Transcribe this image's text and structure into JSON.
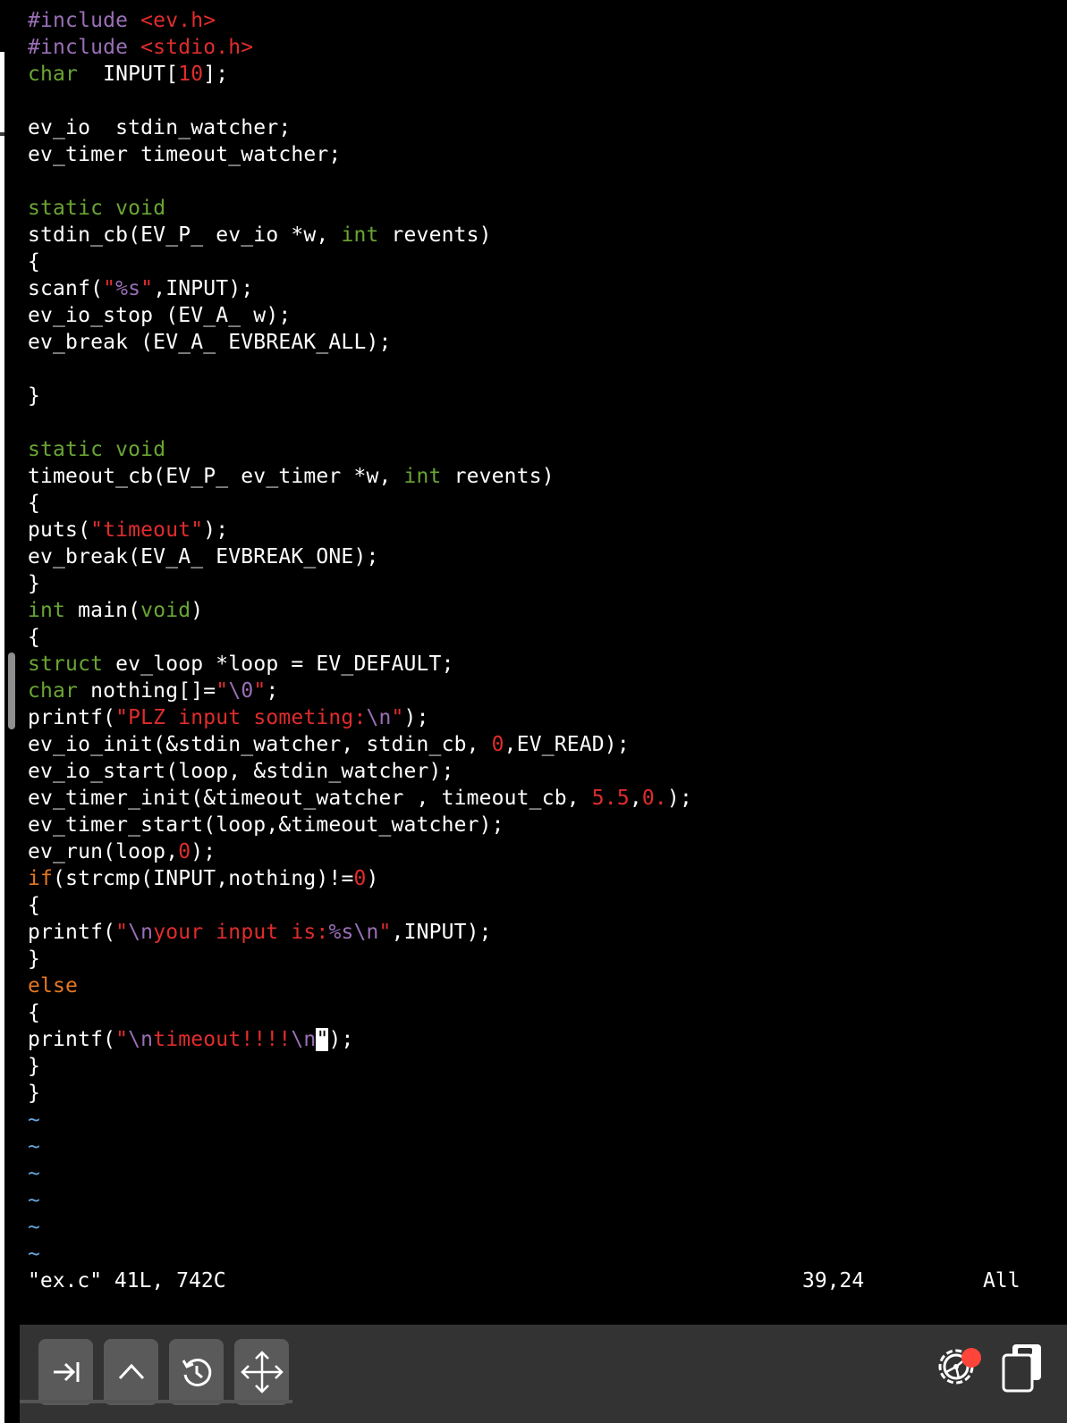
{
  "editor": {
    "lines": [
      [
        [
          "p",
          "#include "
        ],
        [
          "s",
          "<ev.h>"
        ]
      ],
      [
        [
          "p",
          "#include "
        ],
        [
          "s",
          "<stdio.h>"
        ]
      ],
      [
        [
          "k",
          "char"
        ],
        [
          "",
          "  INPUT["
        ],
        [
          "s",
          "10"
        ],
        [
          "",
          "];"
        ]
      ],
      [],
      [
        [
          "",
          "ev_io  stdin_watcher;"
        ]
      ],
      [
        [
          "",
          "ev_timer timeout_watcher;"
        ]
      ],
      [],
      [
        [
          "k",
          "static"
        ],
        [
          "",
          " "
        ],
        [
          "k",
          "void"
        ]
      ],
      [
        [
          "",
          "stdin_cb(EV_P_ ev_io *w, "
        ],
        [
          "k",
          "int"
        ],
        [
          "",
          " revents)"
        ]
      ],
      [
        [
          "",
          "{"
        ]
      ],
      [
        [
          "",
          "scanf("
        ],
        [
          "s",
          "\""
        ],
        [
          "p",
          "%s"
        ],
        [
          "s",
          "\""
        ],
        [
          "",
          ",INPUT);"
        ]
      ],
      [
        [
          "",
          "ev_io_stop (EV_A_ w);"
        ]
      ],
      [
        [
          "",
          "ev_break (EV_A_ EVBREAK_ALL);"
        ]
      ],
      [],
      [
        [
          "",
          "}"
        ]
      ],
      [],
      [
        [
          "k",
          "static"
        ],
        [
          "",
          " "
        ],
        [
          "k",
          "void"
        ]
      ],
      [
        [
          "",
          "timeout_cb(EV_P_ ev_timer *w, "
        ],
        [
          "k",
          "int"
        ],
        [
          "",
          " revents)"
        ]
      ],
      [
        [
          "",
          "{"
        ]
      ],
      [
        [
          "",
          "puts("
        ],
        [
          "s",
          "\"timeout\""
        ],
        [
          "",
          ");"
        ]
      ],
      [
        [
          "",
          "ev_break(EV_A_ EVBREAK_ONE);"
        ]
      ],
      [
        [
          "",
          "}"
        ]
      ],
      [
        [
          "k",
          "int"
        ],
        [
          "",
          " main("
        ],
        [
          "k",
          "void"
        ],
        [
          "",
          ")"
        ]
      ],
      [
        [
          "",
          "{"
        ]
      ],
      [
        [
          "k",
          "struct"
        ],
        [
          "",
          " ev_loop *loop = EV_DEFAULT;"
        ]
      ],
      [
        [
          "k",
          "char"
        ],
        [
          "",
          " nothing[]="
        ],
        [
          "s",
          "\""
        ],
        [
          "p",
          "\\0"
        ],
        [
          "s",
          "\""
        ],
        [
          "",
          ";"
        ]
      ],
      [
        [
          "",
          "printf("
        ],
        [
          "s",
          "\"PLZ input someting:"
        ],
        [
          "p",
          "\\n"
        ],
        [
          "s",
          "\""
        ],
        [
          "",
          ");"
        ]
      ],
      [
        [
          "",
          "ev_io_init(&stdin_watcher, stdin_cb, "
        ],
        [
          "s",
          "0"
        ],
        [
          "",
          ",EV_READ);"
        ]
      ],
      [
        [
          "",
          "ev_io_start(loop, &stdin_watcher);"
        ]
      ],
      [
        [
          "",
          "ev_timer_init(&timeout_watcher , timeout_cb, "
        ],
        [
          "s",
          "5.5"
        ],
        [
          "",
          ","
        ],
        [
          "s",
          "0."
        ],
        [
          "",
          ");"
        ]
      ],
      [
        [
          "",
          "ev_timer_start(loop,&timeout_watcher);"
        ]
      ],
      [
        [
          "",
          "ev_run(loop,"
        ],
        [
          "s",
          "0"
        ],
        [
          "",
          ");"
        ]
      ],
      [
        [
          "c",
          "if"
        ],
        [
          "",
          "(strcmp(INPUT,nothing)!="
        ],
        [
          "s",
          "0"
        ],
        [
          "",
          ")"
        ]
      ],
      [
        [
          "",
          "{"
        ]
      ],
      [
        [
          "",
          "printf("
        ],
        [
          "s",
          "\""
        ],
        [
          "p",
          "\\n"
        ],
        [
          "s",
          "your input is:"
        ],
        [
          "p",
          "%s\\n"
        ],
        [
          "s",
          "\""
        ],
        [
          "",
          ",INPUT);"
        ]
      ],
      [
        [
          "",
          "}"
        ]
      ],
      [
        [
          "c",
          "else"
        ]
      ],
      [
        [
          "",
          "{"
        ]
      ],
      [
        [
          "",
          "printf("
        ],
        [
          "s",
          "\""
        ],
        [
          "p",
          "\\n"
        ],
        [
          "s",
          "timeout!!!!"
        ],
        [
          "p",
          "\\n"
        ],
        [
          "cursor",
          "\""
        ],
        [
          "",
          ");"
        ]
      ],
      [
        [
          "",
          "}"
        ]
      ],
      [
        [
          "",
          "}"
        ]
      ],
      [
        [
          "t",
          "~"
        ]
      ],
      [
        [
          "t",
          "~"
        ]
      ],
      [
        [
          "t",
          "~"
        ]
      ],
      [
        [
          "t",
          "~"
        ]
      ],
      [
        [
          "t",
          "~"
        ]
      ],
      [
        [
          "t",
          "~"
        ]
      ]
    ]
  },
  "status": {
    "file": "\"ex.c\" 41L, 742C",
    "position": "39,24",
    "scroll": "All"
  },
  "toolbar": {
    "buttons": [
      "tab-icon",
      "control-caret-icon",
      "history-icon",
      "move-arrows-icon"
    ],
    "right": [
      "settings-gear-icon",
      "clipboard-icon"
    ]
  },
  "colors": {
    "type_keyword": "#6aa534",
    "preprocessor": "#9a6fb7",
    "string": "#e02c2c",
    "control_keyword": "#e6771f",
    "tilde": "#64a6de",
    "badge": "#ff453a"
  }
}
